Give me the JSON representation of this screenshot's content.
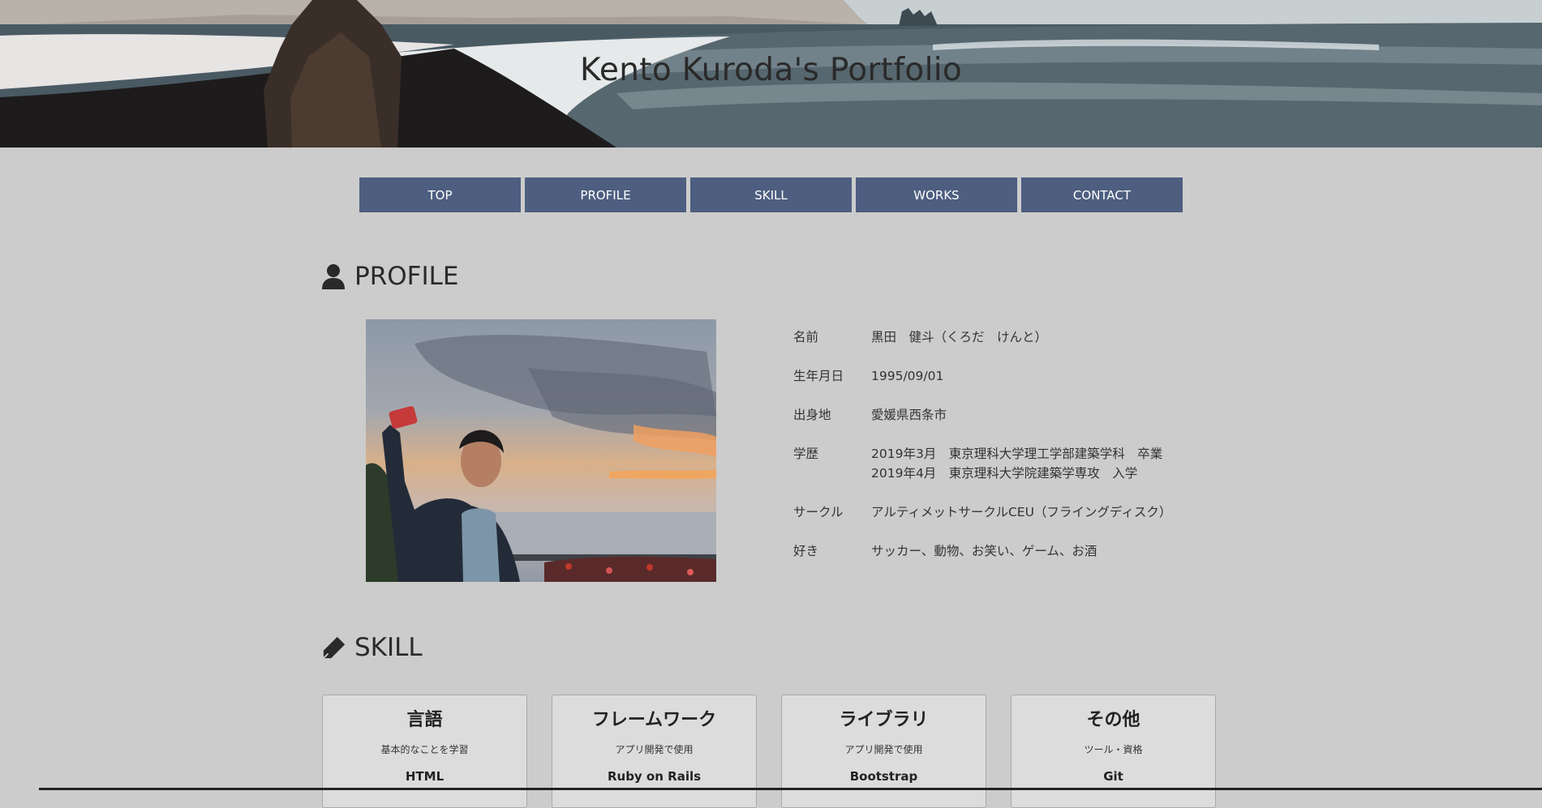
{
  "header": {
    "title": "Kento Kuroda's Portfolio"
  },
  "nav": {
    "items": [
      "TOP",
      "PROFILE",
      "SKILL",
      "WORKS",
      "CONTACT"
    ]
  },
  "profile": {
    "heading": "PROFILE",
    "icon": "user-icon",
    "photo": "selfie-at-sunset-photo",
    "rows": [
      {
        "label": "名前",
        "value": [
          "黒田　健斗（くろだ　けんと）"
        ]
      },
      {
        "label": "生年月日",
        "value": [
          "1995/09/01"
        ]
      },
      {
        "label": "出身地",
        "value": [
          "愛媛県西条市"
        ]
      },
      {
        "label": "学歴",
        "value": [
          "2019年3月　東京理科大学理工学部建築学科　卒業",
          "2019年4月　東京理科大学院建築学専攻　入学"
        ]
      },
      {
        "label": "サークル",
        "value": [
          "アルティメットサークルCEU（フライングディスク）"
        ]
      },
      {
        "label": "好き",
        "value": [
          "サッカー、動物、お笑い、ゲーム、お酒"
        ]
      }
    ]
  },
  "skill": {
    "heading": "SKILL",
    "icon": "pen-icon",
    "cards": [
      {
        "title": "言語",
        "sub": "基本的なことを学習",
        "first": "HTML"
      },
      {
        "title": "フレームワーク",
        "sub": "アプリ開発で使用",
        "first": "Ruby on Rails"
      },
      {
        "title": "ライブラリ",
        "sub": "アプリ開発で使用",
        "first": "Bootstrap"
      },
      {
        "title": "その他",
        "sub": "ツール・資格",
        "first": "Git"
      }
    ]
  },
  "colors": {
    "nav_bg": "#4d5e80",
    "page_bg": "#cccccc",
    "card_bg": "#dcdcdc"
  }
}
